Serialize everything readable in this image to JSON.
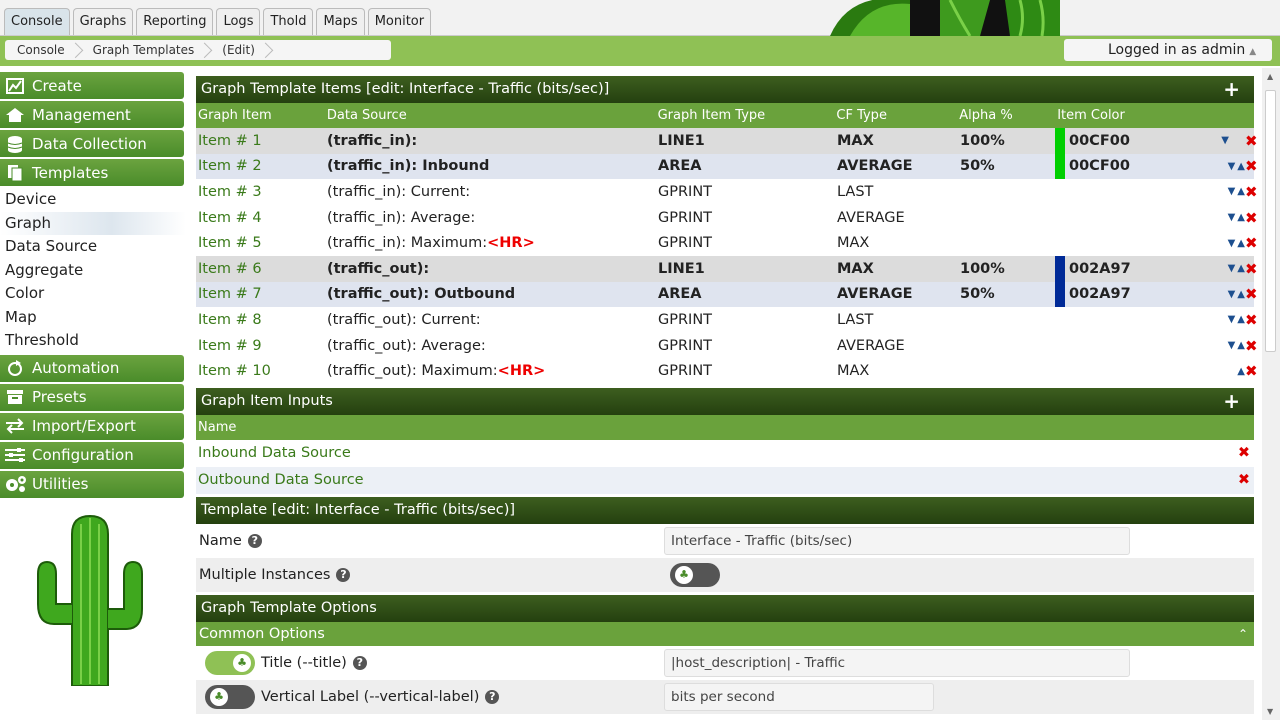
{
  "tabs": [
    "Console",
    "Graphs",
    "Reporting",
    "Logs",
    "Thold",
    "Maps",
    "Monitor"
  ],
  "breadcrumb": [
    "Console",
    "Graph Templates",
    "(Edit)"
  ],
  "login": "Logged in as admin",
  "sidebar": {
    "categories": {
      "create": "Create",
      "management": "Management",
      "data_collection": "Data Collection",
      "templates": "Templates",
      "automation": "Automation",
      "presets": "Presets",
      "import_export": "Import/Export",
      "configuration": "Configuration",
      "utilities": "Utilities"
    },
    "template_items": [
      "Device",
      "Graph",
      "Data Source",
      "Aggregate",
      "Color",
      "Map",
      "Threshold"
    ]
  },
  "items_section": {
    "title": "Graph Template Items [edit: Interface - Traffic (bits/sec)]",
    "columns": [
      "Graph Item",
      "Data Source",
      "Graph Item Type",
      "CF Type",
      "Alpha %",
      "Item Color"
    ],
    "rows": [
      {
        "item": "Item # 1",
        "ds": "(traffic_in):",
        "hr": "",
        "type": "LINE1",
        "cf": "MAX",
        "alpha": "100%",
        "color": "00CF00",
        "hex": "#00cf00"
      },
      {
        "item": "Item # 2",
        "ds": "(traffic_in): Inbound",
        "hr": "",
        "type": "AREA",
        "cf": "AVERAGE",
        "alpha": "50%",
        "color": "00CF00",
        "hex": "#00cf00"
      },
      {
        "item": "Item # 3",
        "ds": "(traffic_in): Current:",
        "hr": "",
        "type": "GPRINT",
        "cf": "LAST",
        "alpha": "",
        "color": "",
        "hex": ""
      },
      {
        "item": "Item # 4",
        "ds": "(traffic_in): Average:",
        "hr": "",
        "type": "GPRINT",
        "cf": "AVERAGE",
        "alpha": "",
        "color": "",
        "hex": ""
      },
      {
        "item": "Item # 5",
        "ds": "(traffic_in): Maximum:",
        "hr": "<HR>",
        "type": "GPRINT",
        "cf": "MAX",
        "alpha": "",
        "color": "",
        "hex": ""
      },
      {
        "item": "Item # 6",
        "ds": "(traffic_out):",
        "hr": "",
        "type": "LINE1",
        "cf": "MAX",
        "alpha": "100%",
        "color": "002A97",
        "hex": "#002a97"
      },
      {
        "item": "Item # 7",
        "ds": "(traffic_out): Outbound",
        "hr": "",
        "type": "AREA",
        "cf": "AVERAGE",
        "alpha": "50%",
        "color": "002A97",
        "hex": "#002a97"
      },
      {
        "item": "Item # 8",
        "ds": "(traffic_out): Current:",
        "hr": "",
        "type": "GPRINT",
        "cf": "LAST",
        "alpha": "",
        "color": "",
        "hex": ""
      },
      {
        "item": "Item # 9",
        "ds": "(traffic_out): Average:",
        "hr": "",
        "type": "GPRINT",
        "cf": "AVERAGE",
        "alpha": "",
        "color": "",
        "hex": ""
      },
      {
        "item": "Item # 10",
        "ds": "(traffic_out): Maximum:",
        "hr": "<HR>",
        "type": "GPRINT",
        "cf": "MAX",
        "alpha": "",
        "color": "",
        "hex": ""
      }
    ]
  },
  "inputs_section": {
    "title": "Graph Item Inputs",
    "column": "Name",
    "rows": [
      "Inbound Data Source",
      "Outbound Data Source"
    ]
  },
  "template_section": {
    "title": "Template [edit: Interface - Traffic (bits/sec)]",
    "name_label": "Name",
    "name_value": "Interface - Traffic (bits/sec)",
    "multi_label": "Multiple Instances"
  },
  "options_section": {
    "title": "Graph Template Options",
    "common": "Common Options",
    "title_label": "Title (--title)",
    "title_value": "|host_description| - Traffic",
    "vlabel_label": "Vertical Label (--vertical-label)",
    "vlabel_value": "bits per second"
  }
}
